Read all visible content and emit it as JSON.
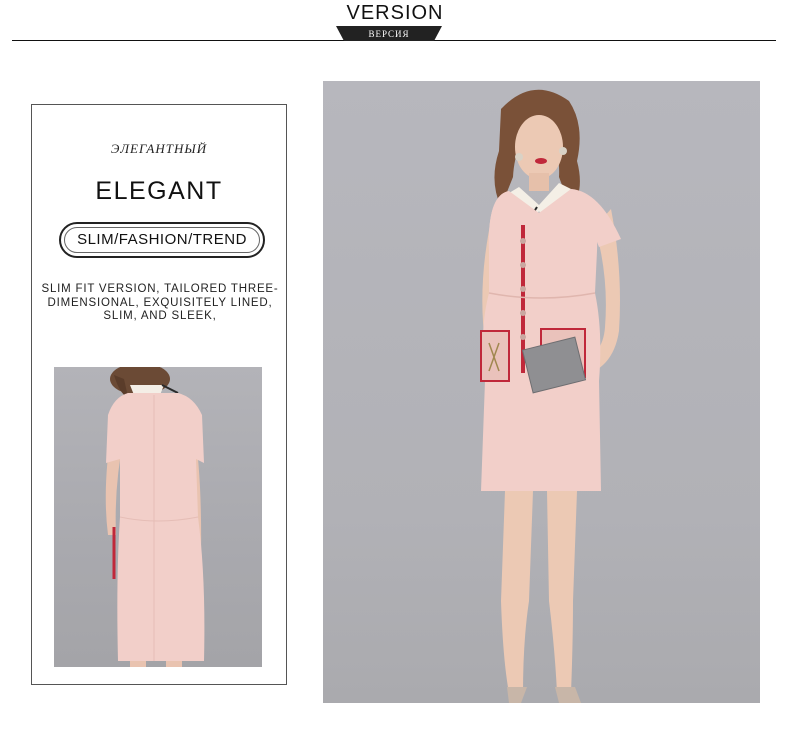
{
  "header": {
    "title": "VERSION",
    "tag": "ВЕРСИЯ"
  },
  "info_card": {
    "subtitle_ru": "ЭЛЕГАНТНЫЙ",
    "heading": "ELEGANT",
    "pill_label": "SLIM/FASHION/TREND",
    "description": "SLIM FIT VERSION, TAILORED THREE-DIMENSIONAL, EXQUISITELY LINED, SLIM, AND SLEEK,"
  },
  "colors": {
    "dress_pink": "#f2cfc9",
    "background_grey": "#b3b3b8",
    "accent_red": "#c0283a",
    "text_dark": "#111111"
  }
}
